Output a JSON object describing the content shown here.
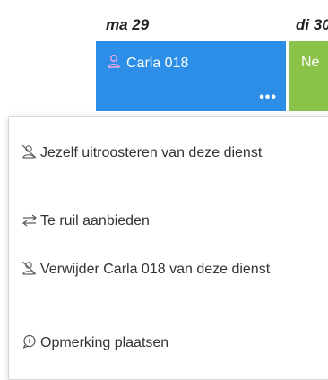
{
  "calendar": {
    "days": [
      {
        "label": "ma 29"
      },
      {
        "label": "di 30"
      }
    ],
    "shift": {
      "person": "Carla 018",
      "more": "•••",
      "color": "#2c8ee6"
    },
    "next_shift": {
      "label": "Ne",
      "color": "#8bc24a"
    }
  },
  "menu": {
    "items": [
      {
        "label": "Jezelf uitroosteren van deze dienst",
        "icon": "person-remove-icon"
      },
      {
        "label": "Te ruil aanbieden",
        "icon": "swap-arrows-icon"
      },
      {
        "label": "Verwijder Carla 018 van deze dienst",
        "icon": "person-remove-icon"
      },
      {
        "label": "Opmerking plaatsen",
        "icon": "comment-add-icon"
      }
    ]
  }
}
